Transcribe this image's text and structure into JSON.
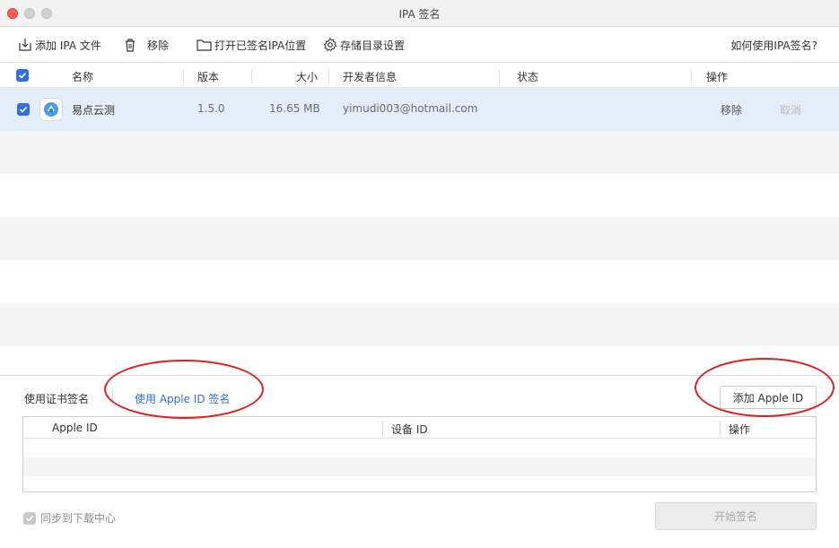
{
  "window": {
    "title": "IPA 签名"
  },
  "toolbar": {
    "add_ipa": "添加 IPA 文件",
    "remove": "移除",
    "open_location": "打开已签名IPA位置",
    "storage_settings": "存储目录设置",
    "help": "如何使用IPA签名?"
  },
  "table": {
    "columns": {
      "name": "名称",
      "version": "版本",
      "size": "大小",
      "developer": "开发者信息",
      "status": "状态",
      "actions": "操作"
    },
    "rows": [
      {
        "checked": true,
        "name": "易点云测",
        "version": "1.5.0",
        "size": "16.65 MB",
        "developer": "yimudi003@hotmail.com",
        "status": "",
        "action_remove": "移除",
        "action_cancel": "取消"
      }
    ]
  },
  "signing": {
    "tab_certificate": "使用证书签名",
    "tab_apple_id": "使用 Apple ID 签名",
    "add_apple_id": "添加 Apple ID",
    "columns": {
      "apple_id": "Apple ID",
      "device_id": "设备 ID",
      "actions": "操作"
    },
    "sync_label": "同步到下载中心",
    "start_button": "开始签名"
  },
  "colors": {
    "accent": "#2f6fe0",
    "selected_row": "#e4edfa",
    "annotation": "#e02020",
    "close": "#ff5f57"
  }
}
